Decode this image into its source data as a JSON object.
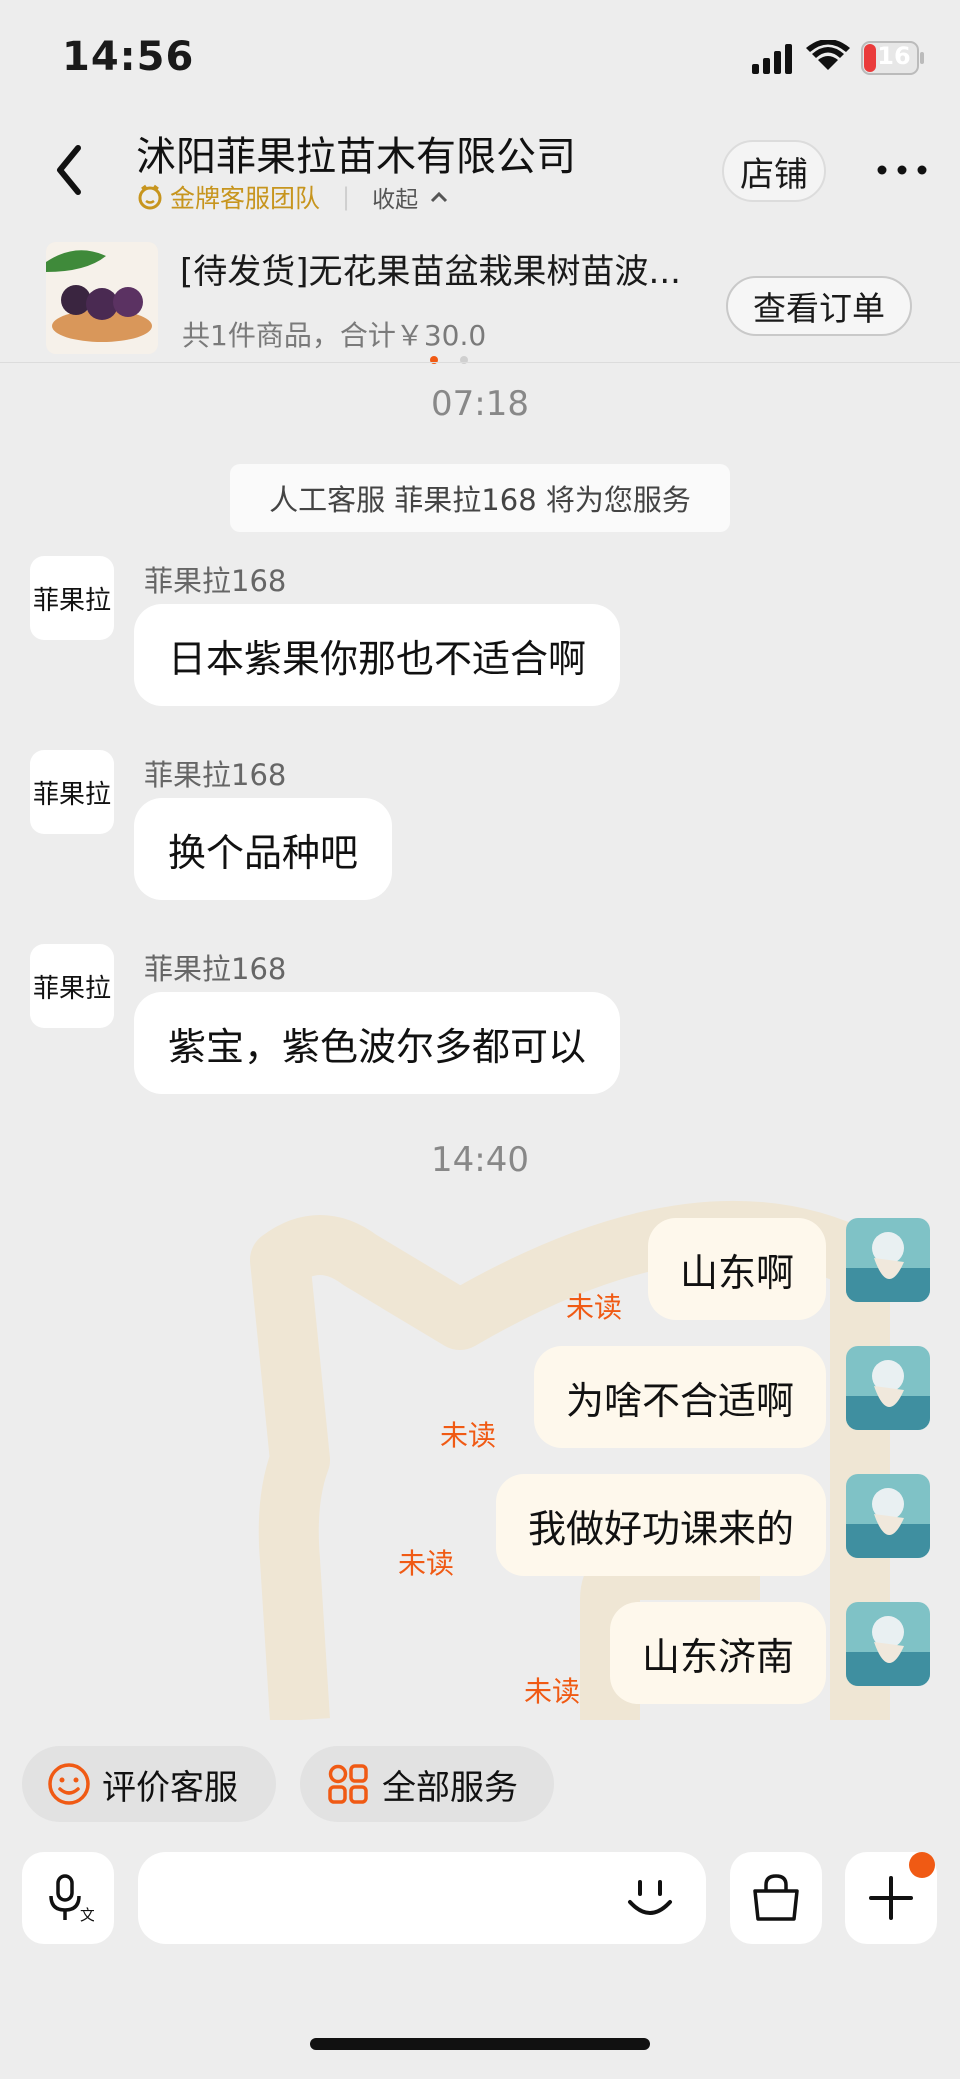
{
  "status_bar": {
    "time": "14:56",
    "battery": "16"
  },
  "header": {
    "shop_name": "沭阳菲果拉苗木有限公司",
    "team_label": "金牌客服团队",
    "collapse_label": "收起",
    "store_button": "店铺"
  },
  "order": {
    "title": "[待发货]无花果苗盆栽果树苗波...",
    "summary": "共1件商品，合计￥30.0",
    "view_button": "查看订单"
  },
  "chat": {
    "time_1": "07:18",
    "system_notice": "人工客服 菲果拉168 将为您服务",
    "shop_avatar_text": "菲果拉",
    "incoming": [
      {
        "sender": "菲果拉168",
        "text": "日本紫果你那也不适合啊"
      },
      {
        "sender": "菲果拉168",
        "text": "换个品种吧"
      },
      {
        "sender": "菲果拉168",
        "text": "紫宝，紫色波尔多都可以"
      }
    ],
    "time_2": "14:40",
    "outgoing": [
      {
        "text": "山东啊",
        "status": "未读"
      },
      {
        "text": "为啥不合适啊",
        "status": "未读"
      },
      {
        "text": "我做好功课来的",
        "status": "未读"
      },
      {
        "text": "山东济南",
        "status": "未读"
      }
    ]
  },
  "quick_actions": {
    "rate": "评价客服",
    "all_services": "全部服务"
  },
  "input": {
    "placeholder": ""
  },
  "colors": {
    "accent": "#f05a14",
    "gold": "#c7951e",
    "bubble_out": "#fef8ec",
    "bg": "#ededed"
  }
}
